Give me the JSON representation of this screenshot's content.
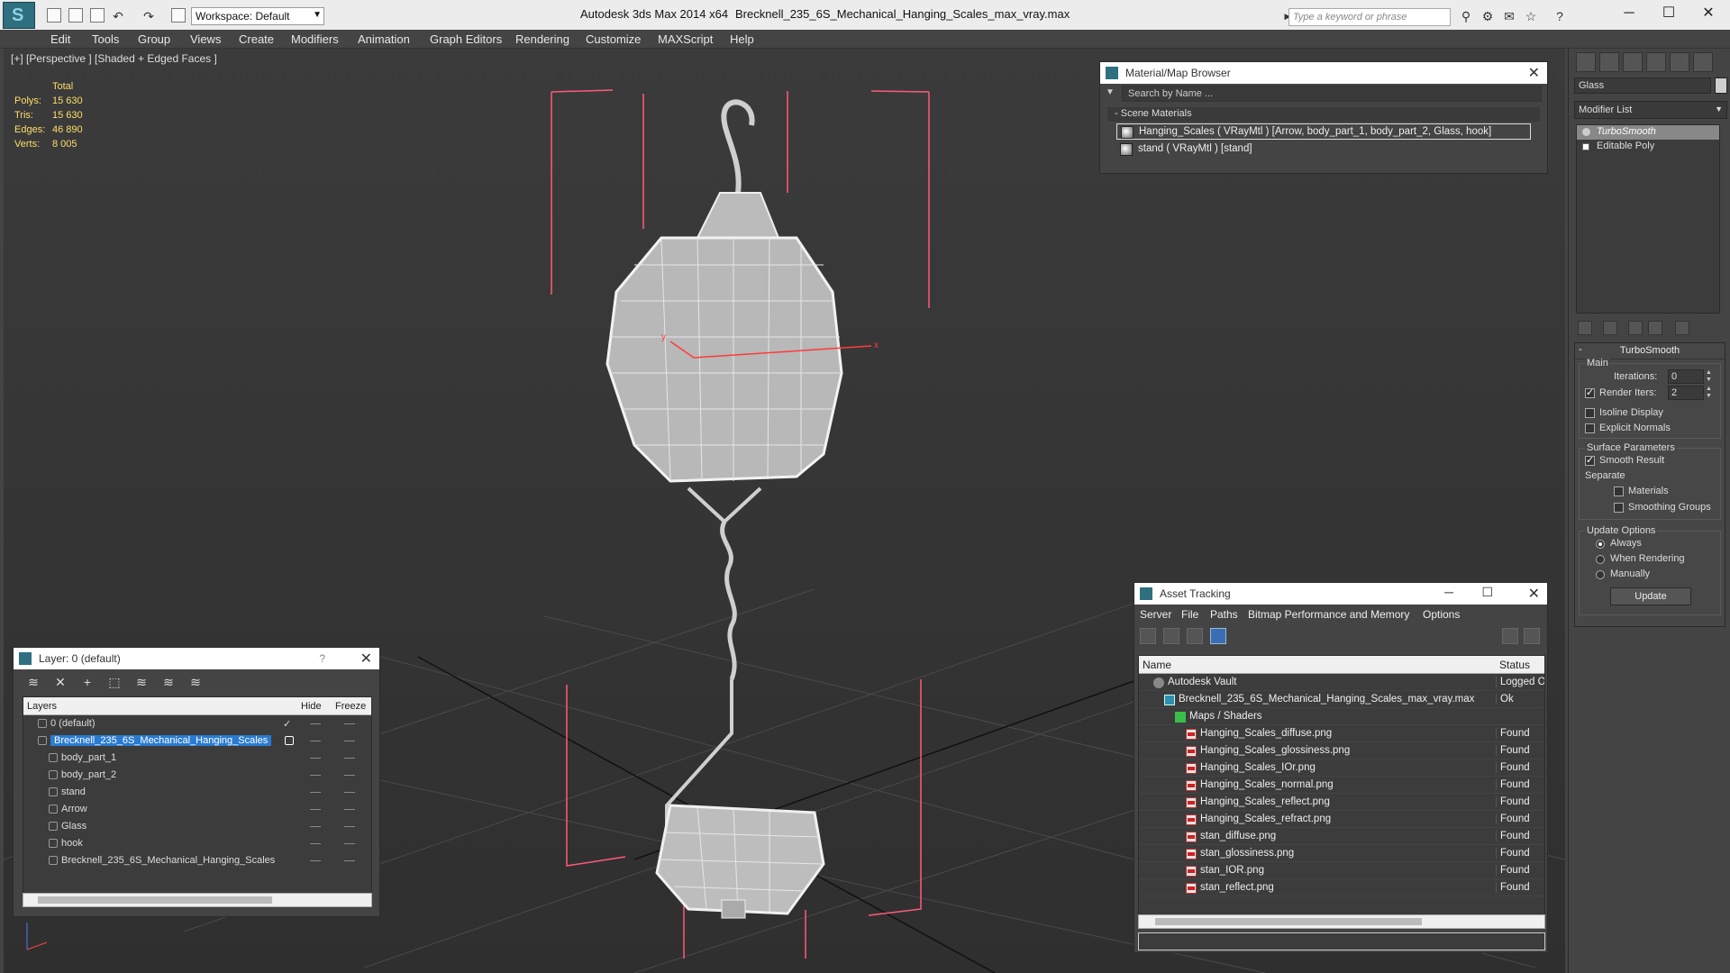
{
  "window": {
    "app_title": "Autodesk 3ds Max  2014 x64",
    "file_title": "Brecknell_235_6S_Mechanical_Hanging_Scales_max_vray.max",
    "workspace": "Workspace: Default",
    "search_placeholder": "Type a keyword or phrase"
  },
  "menu": [
    "Edit",
    "Tools",
    "Group",
    "Views",
    "Create",
    "Modifiers",
    "Animation",
    "Graph Editors",
    "Rendering",
    "Customize",
    "MAXScript",
    "Help"
  ],
  "viewport": {
    "label": "[+] [Perspective ] [Shaded + Edged Faces ]",
    "stats": {
      "header": "Total",
      "rows": [
        {
          "label": "Polys:",
          "value": "15 630"
        },
        {
          "label": "Tris:",
          "value": "15 630"
        },
        {
          "label": "Edges:",
          "value": "46 890"
        },
        {
          "label": "Verts:",
          "value": "8 005"
        }
      ]
    },
    "axis_x": "x",
    "axis_y": "y"
  },
  "material_browser": {
    "title": "Material/Map Browser",
    "search_placeholder": "Search by Name ...",
    "section": "Scene Materials",
    "materials": [
      "Hanging_Scales  ( VRayMtl ) [Arrow, body_part_1, body_part_2, Glass, hook]",
      "stand  ( VRayMtl ) [stand]"
    ]
  },
  "layer_panel": {
    "title": "Layer: 0 (default)",
    "help": "?",
    "columns": {
      "layers": "Layers",
      "hide": "Hide",
      "freeze": "Freeze"
    },
    "rows": [
      {
        "name": "0 (default)",
        "level": 1
      },
      {
        "name": "Brecknell_235_6S_Mechanical_Hanging_Scales",
        "level": 1
      },
      {
        "name": "body_part_1",
        "level": 2
      },
      {
        "name": "body_part_2",
        "level": 2
      },
      {
        "name": "stand",
        "level": 2
      },
      {
        "name": "Arrow",
        "level": 2
      },
      {
        "name": "Glass",
        "level": 2
      },
      {
        "name": "hook",
        "level": 2
      },
      {
        "name": "Brecknell_235_6S_Mechanical_Hanging_Scales",
        "level": 2
      }
    ]
  },
  "asset_tracking": {
    "title": "Asset Tracking",
    "menu": [
      "Server",
      "File",
      "Paths",
      "Bitmap Performance and Memory",
      "Options"
    ],
    "columns": {
      "name": "Name",
      "status": "Status"
    },
    "rows": [
      {
        "name": "Autodesk Vault",
        "status": "Logged O",
        "indent": 1
      },
      {
        "name": "Brecknell_235_6S_Mechanical_Hanging_Scales_max_vray.max",
        "status": "Ok",
        "indent": 2
      },
      {
        "name": "Maps / Shaders",
        "status": "",
        "indent": 3
      },
      {
        "name": "Hanging_Scales_diffuse.png",
        "status": "Found",
        "indent": 4
      },
      {
        "name": "Hanging_Scales_glossiness.png",
        "status": "Found",
        "indent": 4
      },
      {
        "name": "Hanging_Scales_IOr.png",
        "status": "Found",
        "indent": 4
      },
      {
        "name": "Hanging_Scales_normal.png",
        "status": "Found",
        "indent": 4
      },
      {
        "name": "Hanging_Scales_reflect.png",
        "status": "Found",
        "indent": 4
      },
      {
        "name": "Hanging_Scales_refract.png",
        "status": "Found",
        "indent": 4
      },
      {
        "name": "stan_diffuse.png",
        "status": "Found",
        "indent": 4
      },
      {
        "name": "stan_glossiness.png",
        "status": "Found",
        "indent": 4
      },
      {
        "name": "stan_IOR.png",
        "status": "Found",
        "indent": 4
      },
      {
        "name": "stan_reflect.png",
        "status": "Found",
        "indent": 4
      }
    ]
  },
  "command_panel": {
    "object_name": "Glass",
    "modifier_list": "Modifier List",
    "stack": [
      "TurboSmooth",
      "Editable Poly"
    ],
    "turbosmooth": {
      "title": "TurboSmooth",
      "main": "Main",
      "iterations_label": "Iterations:",
      "iterations": "0",
      "render_iters_label": "Render Iters:",
      "render_iters": "2",
      "isoline": "Isoline Display",
      "explicit_normals": "Explicit Normals",
      "surface_params": "Surface Parameters",
      "smooth_result": "Smooth Result",
      "separate": "Separate",
      "materials": "Materials",
      "smoothing_groups": "Smoothing Groups",
      "update_options": "Update Options",
      "always": "Always",
      "when_rendering": "When Rendering",
      "manually": "Manually",
      "update": "Update"
    }
  },
  "colors": {
    "accent": "#2a7bd1",
    "stat_text": "#ffde6a",
    "bbox": "#ff5a7a"
  }
}
